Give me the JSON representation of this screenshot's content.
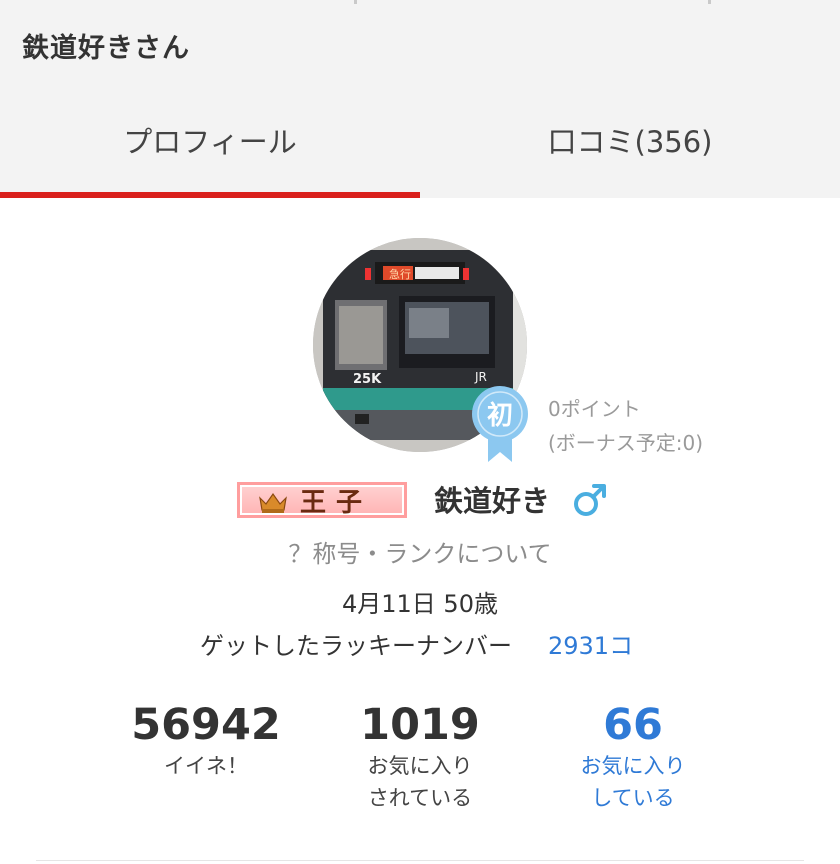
{
  "header": {
    "title": "鉄道好きさん"
  },
  "tabs": [
    {
      "label": "プロフィール",
      "active": true
    },
    {
      "label": "口コミ(356)",
      "active": false
    }
  ],
  "profile": {
    "badge_text": "初",
    "points": "0ポイント",
    "bonus": "(ボーナス予定:0)",
    "rank_title": "王子",
    "username": "鉄道好き",
    "gender_symbol": "♂",
    "rank_info_link": "？称号・ランクについて",
    "birthday": "4月11日 50歳",
    "lucky_label": "ゲットしたラッキーナンバー",
    "lucky_count": "2931コ",
    "train_sign": "急行",
    "train_number": "25K",
    "train_logo": "JR"
  },
  "stats": [
    {
      "value": "56942",
      "label_line1": "イイネ！",
      "label_line2": ""
    },
    {
      "value": "1019",
      "label_line1": "お気に入り",
      "label_line2": "されている"
    },
    {
      "value": "66",
      "label_line1": "お気に入り",
      "label_line2": "している"
    }
  ],
  "colors": {
    "active_tab_underline": "#d9201c",
    "link": "#2f7ad6",
    "gender": "#4aaee0",
    "badge": "#8cc8f0"
  }
}
